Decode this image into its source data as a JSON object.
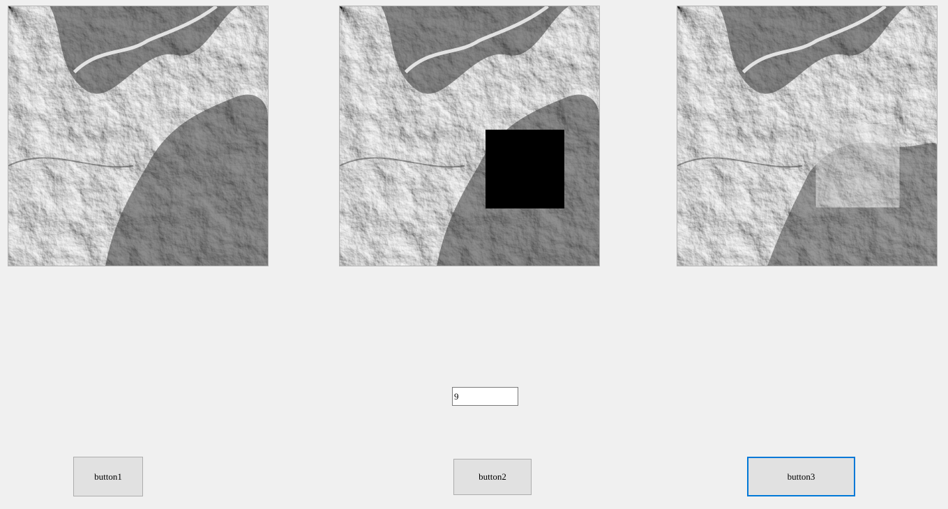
{
  "form": {
    "images": [
      {
        "name": "original-image",
        "content": "grayscale shaded-relief terrain"
      },
      {
        "name": "masked-image",
        "content": "grayscale shaded-relief terrain with black square region"
      },
      {
        "name": "result-image",
        "content": "grayscale shaded-relief terrain with filled region"
      }
    ],
    "textbox": {
      "value": "9"
    },
    "buttons": {
      "button1": "button1",
      "button2": "button2",
      "button3": "button3"
    },
    "colors": {
      "background": "#f0f0f0",
      "button_face": "#e1e1e1",
      "focus_border": "#0078d7",
      "mask": "#000000"
    }
  }
}
